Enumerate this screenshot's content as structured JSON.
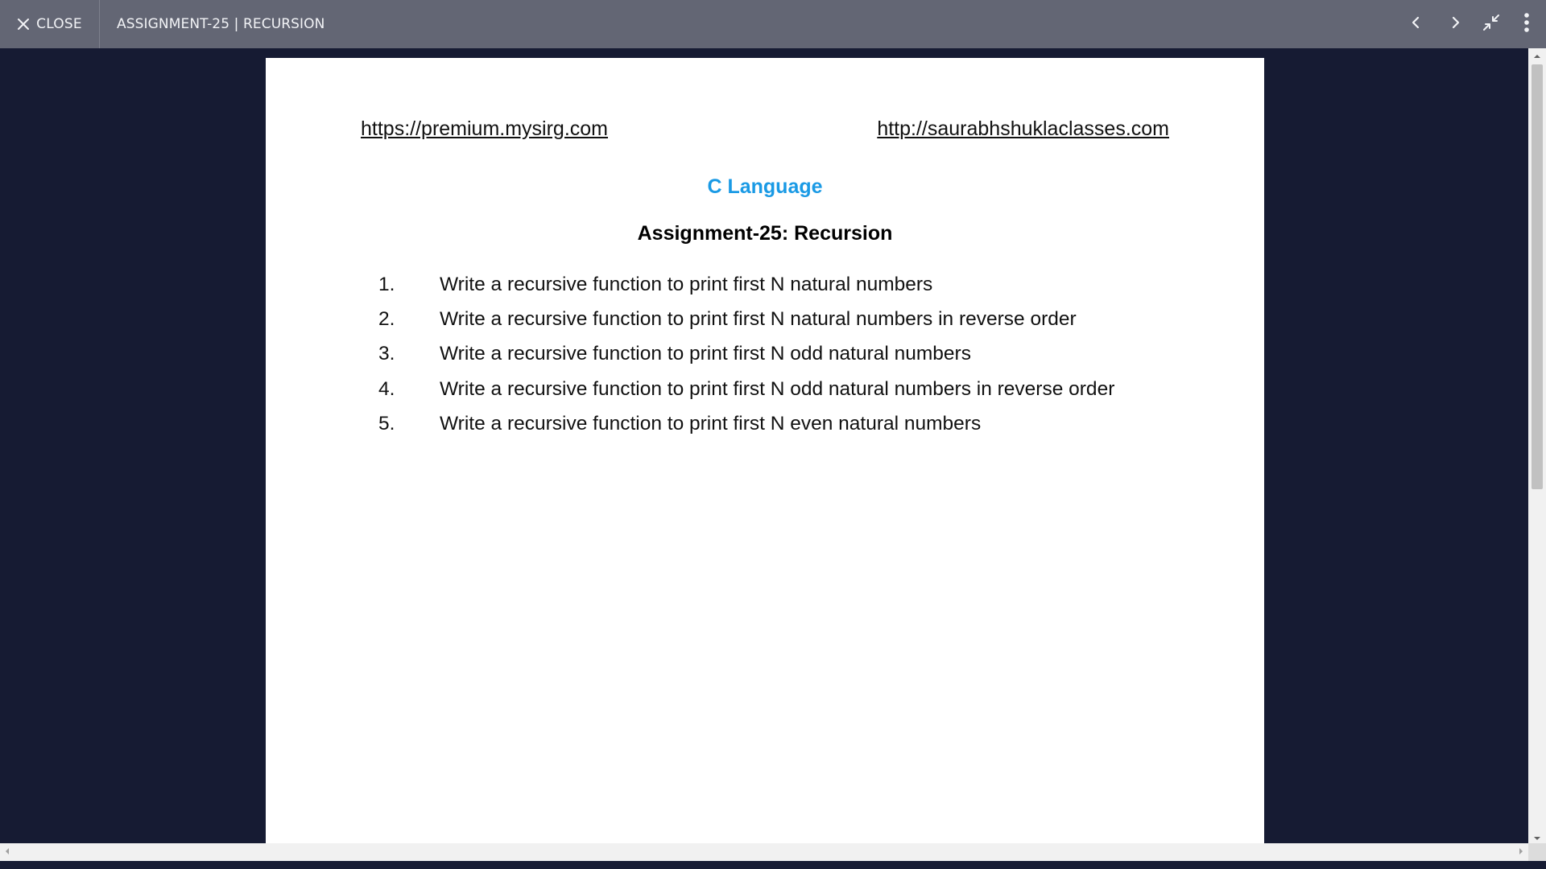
{
  "toolbar": {
    "close_label": "CLOSE",
    "document_title": "ASSIGNMENT-25 | RECURSION",
    "icons": [
      "close-icon",
      "chevron-left-icon",
      "chevron-right-icon",
      "collapse-icon",
      "more-vertical-icon"
    ]
  },
  "document": {
    "link_left": "https://premium.mysirg.com",
    "link_right": "http://saurabhshuklaclasses.com",
    "subject": "C Language",
    "title": "Assignment-25: Recursion",
    "questions": [
      {
        "num": "1.",
        "text": "Write a recursive function to print first N natural numbers"
      },
      {
        "num": "2.",
        "text": "Write a recursive function to print first N natural numbers in reverse order"
      },
      {
        "num": "3.",
        "text": "Write a recursive function to print first N odd natural numbers"
      },
      {
        "num": "4.",
        "text": "Write a recursive function to print first N odd natural numbers in reverse order"
      },
      {
        "num": "5.",
        "text": "Write a recursive function to print first N even natural numbers"
      }
    ]
  },
  "colors": {
    "toolbar_bg": "#636674",
    "viewer_bg": "#161b33",
    "subject_color": "#1a9ae5"
  }
}
